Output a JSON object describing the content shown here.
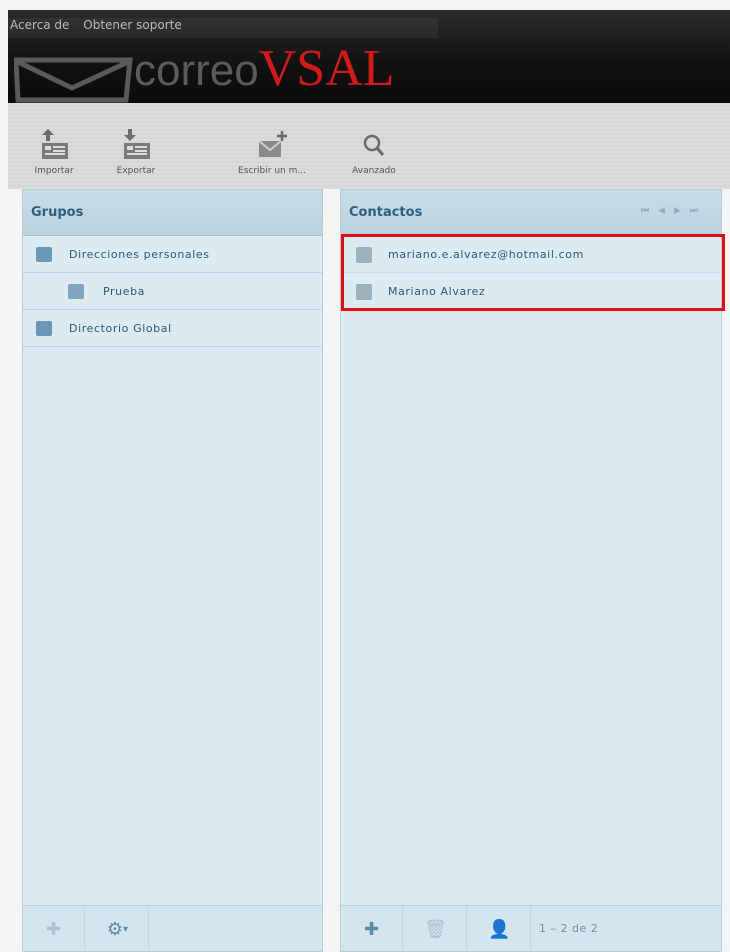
{
  "header": {
    "links": [
      "Acerca de",
      "Obtener soporte"
    ],
    "logo_part1": "correo",
    "logo_part2": "VSAL"
  },
  "toolbar": {
    "import_label": "Importar",
    "export_label": "Exportar",
    "compose_label": "Escribir un m...",
    "advanced_label": "Avanzado"
  },
  "groups": {
    "title": "Grupos",
    "items": [
      {
        "label": "Direcciones personales",
        "icon": "address-book-icon"
      },
      {
        "label": "Prueba",
        "icon": "group-icon"
      },
      {
        "label": "Directorio Global",
        "icon": "address-book-icon"
      }
    ]
  },
  "contacts": {
    "title": "Contactos",
    "items": [
      {
        "label": "mariano.e.alvarez@hotmail.com",
        "icon": "contact-icon"
      },
      {
        "label": "Mariano Alvarez",
        "icon": "contact-icon"
      }
    ],
    "count_text": "1 – 2 de 2"
  },
  "colors": {
    "accent": "#d11b1b",
    "highlight_border": "#e01010",
    "panel_bg": "#dcebf1"
  }
}
